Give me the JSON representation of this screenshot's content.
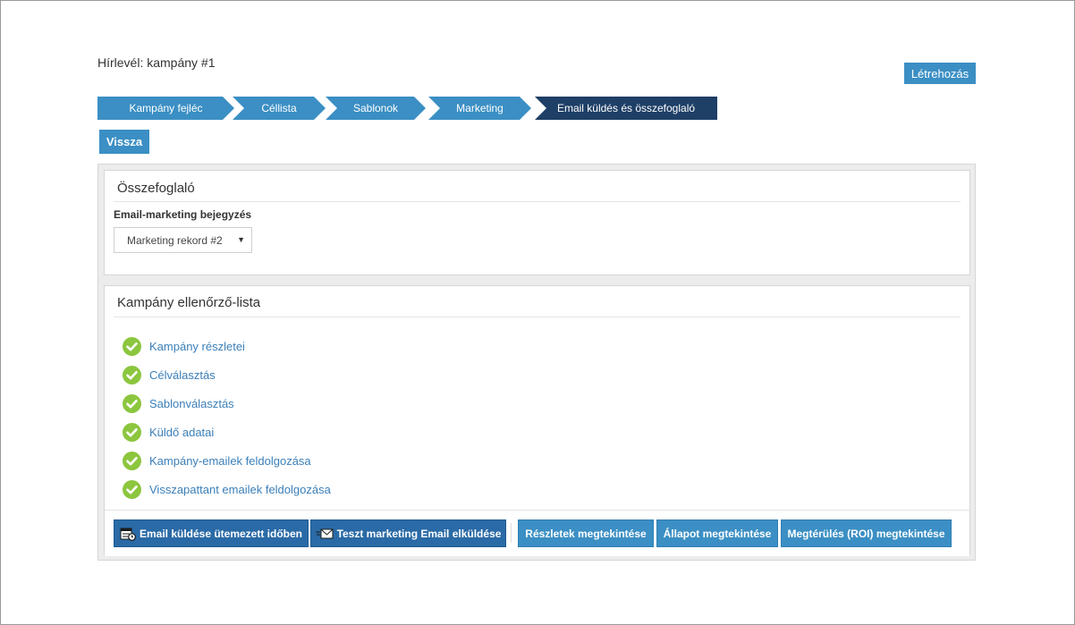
{
  "page": {
    "title": "Hírlevél: kampány #1",
    "create_label": "Létrehozás",
    "back_label": "Vissza"
  },
  "steps": [
    {
      "label": "Kampány fejléc",
      "active": false
    },
    {
      "label": "Céllista",
      "active": false
    },
    {
      "label": "Sablonok",
      "active": false
    },
    {
      "label": "Marketing",
      "active": false
    },
    {
      "label": "Email küldés és összefoglaló",
      "active": true
    }
  ],
  "summary": {
    "title": "Összefoglaló",
    "field_label": "Email-marketing bejegyzés",
    "select_value": "Marketing rekord #2"
  },
  "checklist": {
    "title": "Kampány ellenőrző-lista",
    "items": [
      {
        "label": "Kampány részletei",
        "done": true
      },
      {
        "label": "Célválasztás",
        "done": true
      },
      {
        "label": "Sablonválasztás",
        "done": true
      },
      {
        "label": "Küldő adatai",
        "done": true
      },
      {
        "label": "Kampány-emailek feldolgozása",
        "done": true
      },
      {
        "label": "Visszapattant emailek feldolgozása",
        "done": true
      }
    ]
  },
  "actions": {
    "schedule_label": "Email küldése ütemezett időben",
    "test_label": "Teszt marketing Email elküldése",
    "details_label": "Részletek megtekintése",
    "status_label": "Állapot megtekintése",
    "roi_label": "Megtérülés (ROI) megtekintése"
  },
  "icons": {
    "check": "check-circle-icon",
    "schedule": "calendar-clock-icon",
    "test": "envelope-send-icon",
    "dropdown": "caret-down-icon"
  },
  "colors": {
    "primary": "#3b8fc4",
    "active_step": "#1e3f66",
    "dark_button": "#2a6aa6",
    "check_green": "#8cc63e",
    "link": "#3b7fb8"
  }
}
